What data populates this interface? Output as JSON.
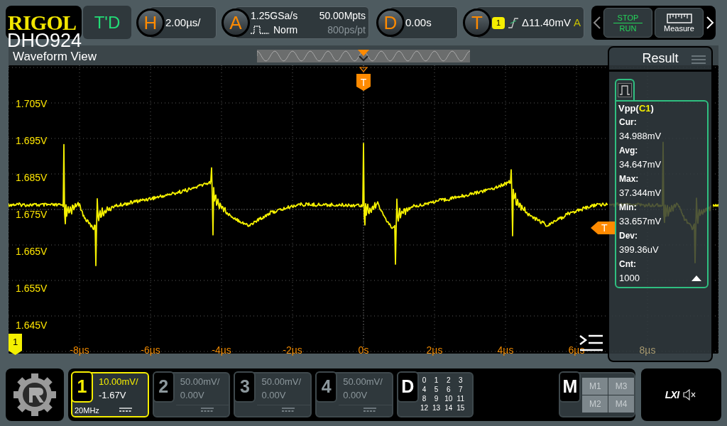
{
  "brand": {
    "logo": "RIGOL",
    "model": "DHO924"
  },
  "top_bar": {
    "run_state": "T'D",
    "horizontal": {
      "key": "H",
      "value": "2.00µs/"
    },
    "acquire": {
      "key": "A",
      "sample_rate": "1.25GSa/s",
      "memory_depth": "50.00Mpts",
      "mode": "Norm",
      "resolution": "800ps/pt"
    },
    "delay": {
      "key": "D",
      "value": "0.00s"
    },
    "trigger": {
      "key": "T",
      "source": "1",
      "level": "Δ11.40mV",
      "sweep": "A"
    }
  },
  "quick_buttons": {
    "stop": "STOP",
    "run": "RUN",
    "measure": "Measure"
  },
  "waveform_view": {
    "title": "Waveform View",
    "trigger_marker": "T",
    "level_marker": "T",
    "channel_marker": "1",
    "y_labels": [
      "1.705V",
      "1.695V",
      "1.685V",
      "1.675V",
      "1.665V",
      "1.655V",
      "1.645V"
    ],
    "x_labels": [
      "-8µs",
      "-6µs",
      "-4µs",
      "-2µs",
      "0s",
      "2µs",
      "4µs",
      "6µs",
      "8µs"
    ]
  },
  "result_panel": {
    "title": "Result",
    "measurement": {
      "name": "Vpp(",
      "source": "C1",
      "close": ")",
      "stats": [
        {
          "label": "Cur:",
          "value": "34.988mV"
        },
        {
          "label": "Avg:",
          "value": "34.647mV"
        },
        {
          "label": "Max:",
          "value": "37.344mV"
        },
        {
          "label": "Min:",
          "value": "33.657mV"
        },
        {
          "label": "Dev:",
          "value": "399.36uV"
        },
        {
          "label": "Cnt:",
          "value": "1000"
        }
      ]
    }
  },
  "channels": [
    {
      "number": "1",
      "scale": "10.00mV/",
      "offset": "-1.67V",
      "bandwidth": "20MHz",
      "selected": true
    },
    {
      "number": "2",
      "scale": "50.00mV/",
      "offset": "0.00V",
      "selected": false
    },
    {
      "number": "3",
      "scale": "50.00mV/",
      "offset": "0.00V",
      "selected": false
    },
    {
      "number": "4",
      "scale": "50.00mV/",
      "offset": "0.00V",
      "selected": false
    }
  ],
  "digital": {
    "key": "D",
    "bits": [
      "0",
      "1",
      "2",
      "3",
      "4",
      "5",
      "6",
      "7",
      "8",
      "9",
      "10",
      "11",
      "12",
      "13",
      "14",
      "15"
    ]
  },
  "math": {
    "key": "M",
    "items": [
      "M1",
      "M3",
      "M2",
      "M4"
    ]
  },
  "status": {
    "lxi": "LXI"
  }
}
